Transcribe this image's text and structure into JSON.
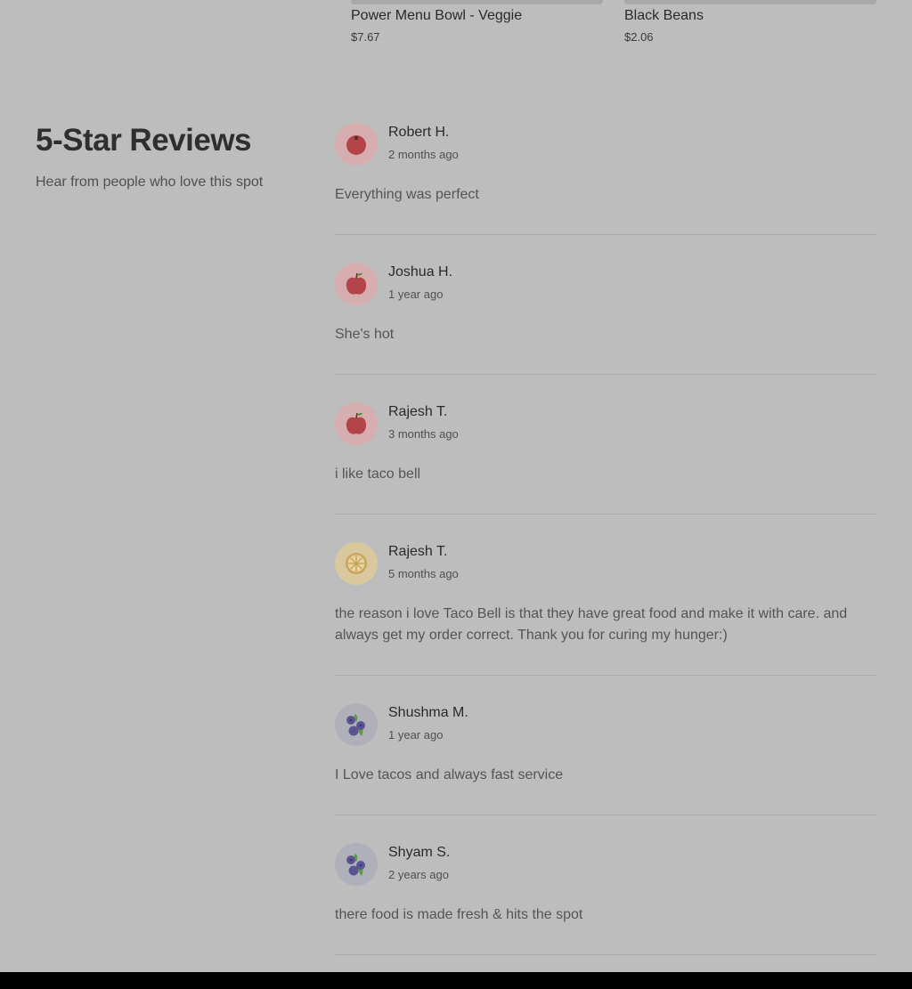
{
  "menu_items": [
    {
      "name": "Power Menu Bowl - Veggie",
      "price": "$7.67"
    },
    {
      "name": "Black Beans",
      "price": "$2.06"
    }
  ],
  "reviews_section": {
    "title": "5-Star Reviews",
    "subtitle": "Hear from people who love this spot",
    "reviews": [
      {
        "name": "Robert H.",
        "time": "2 months ago",
        "text": "Everything was perfect",
        "avatar_icon": "tomato-icon",
        "avatar_bg": "#d6aeb0"
      },
      {
        "name": "Joshua H.",
        "time": "1 year ago",
        "text": "She's hot",
        "avatar_icon": "apple-icon",
        "avatar_bg": "#d6aeb0"
      },
      {
        "name": "Rajesh T.",
        "time": "3 months ago",
        "text": "i like taco bell",
        "avatar_icon": "apple-icon",
        "avatar_bg": "#d6aeb0"
      },
      {
        "name": "Rajesh T.",
        "time": "5 months ago",
        "text": "the reason i love Taco Bell is that they have great food and make it with care. and always get my order correct. Thank you for curing my hunger:)",
        "avatar_icon": "lemon-icon",
        "avatar_bg": "#d9c79e"
      },
      {
        "name": "Shushma M.",
        "time": "1 year ago",
        "text": "I Love tacos and always fast service",
        "avatar_icon": "blueberry-icon",
        "avatar_bg": "#b0b0ba"
      },
      {
        "name": "Shyam S.",
        "time": "2 years ago",
        "text": "there food is made fresh & hits the spot",
        "avatar_icon": "blueberry-icon",
        "avatar_bg": "#b0b0ba"
      }
    ]
  }
}
